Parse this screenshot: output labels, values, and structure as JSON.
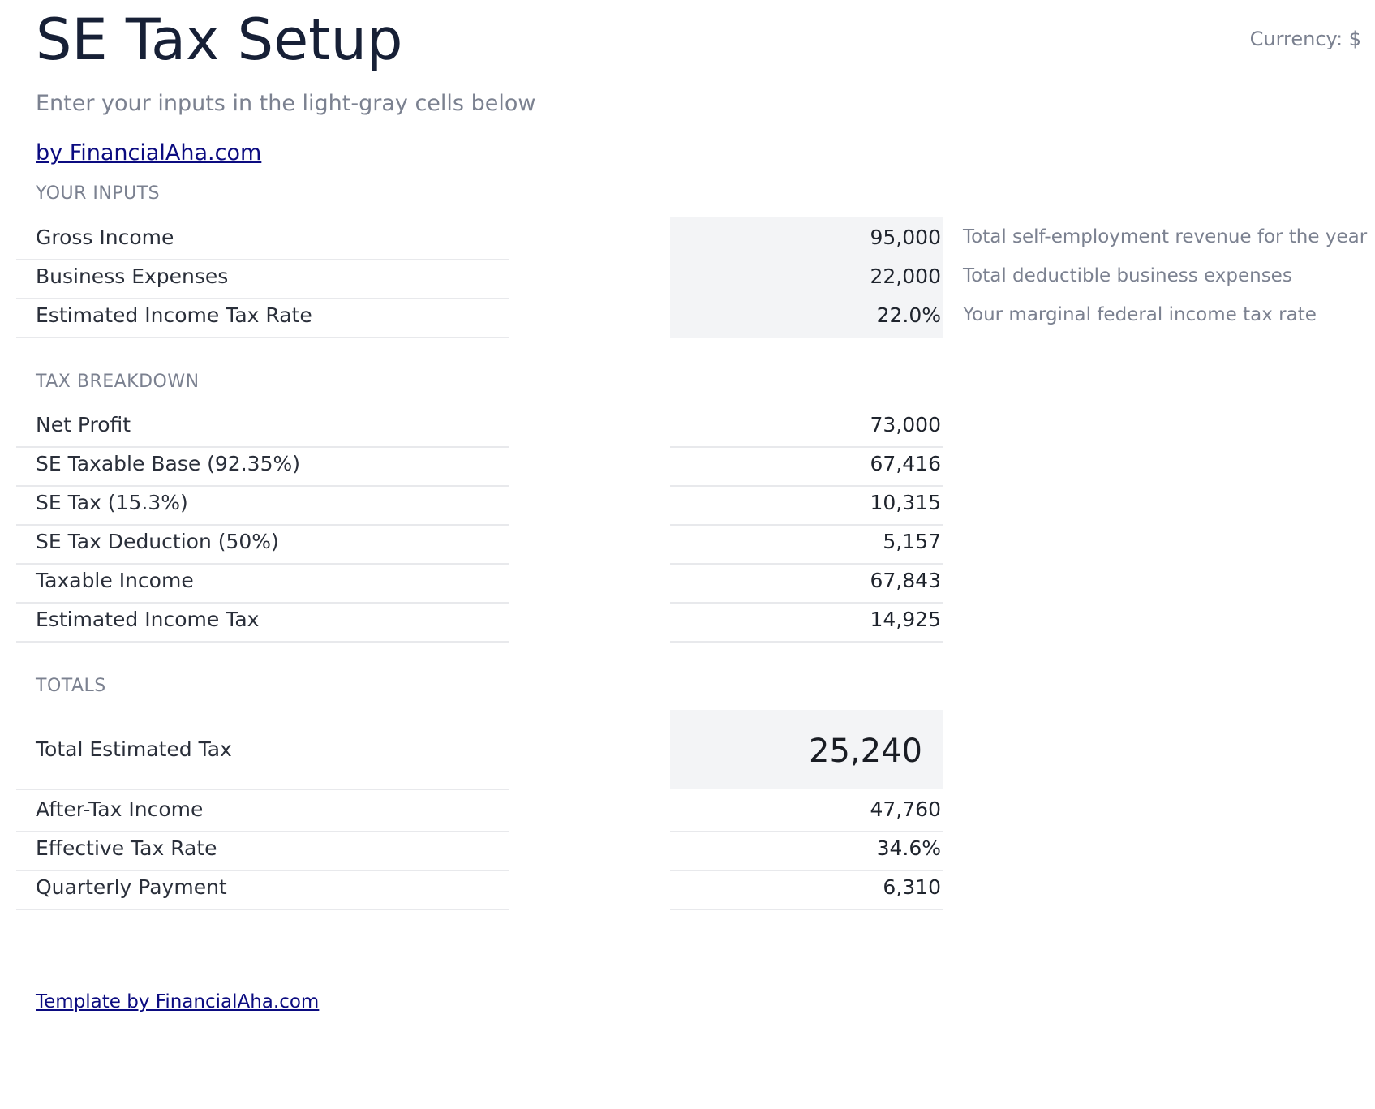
{
  "header": {
    "title": "SE Tax Setup",
    "currency": "Currency: $",
    "subtitle": "Enter your inputs in the light-gray cells below",
    "brand_link": "by FinancialAha.com"
  },
  "inputs": {
    "section_label": "YOUR INPUTS",
    "rows": [
      {
        "label": "Gross Income",
        "value": "95,000",
        "note": "Total self-employment revenue for the year"
      },
      {
        "label": "Business Expenses",
        "value": "22,000",
        "note": "Total deductible business expenses"
      },
      {
        "label": "Estimated Income Tax Rate",
        "value": "22.0%",
        "note": "Your marginal federal income tax rate"
      }
    ]
  },
  "breakdown": {
    "section_label": "TAX BREAKDOWN",
    "rows": [
      {
        "label": "Net Profit",
        "value": "73,000"
      },
      {
        "label": "SE Taxable Base (92.35%)",
        "value": "67,416"
      },
      {
        "label": "SE Tax (15.3%)",
        "value": "10,315"
      },
      {
        "label": "SE Tax Deduction (50%)",
        "value": "5,157"
      },
      {
        "label": "Taxable Income",
        "value": "67,843"
      },
      {
        "label": "Estimated Income Tax",
        "value": "14,925"
      }
    ]
  },
  "totals": {
    "section_label": "TOTALS",
    "total": {
      "label": "Total Estimated Tax",
      "value": "25,240"
    },
    "rows": [
      {
        "label": "After-Tax Income",
        "value": "47,760"
      },
      {
        "label": "Effective Tax Rate",
        "value": "34.6%"
      },
      {
        "label": "Quarterly Payment",
        "value": "6,310"
      }
    ]
  },
  "footer": {
    "link": "Template by FinancialAha.com"
  },
  "colors": {
    "input_cell_bg": "#f3f4f6",
    "title": "#172036",
    "muted": "#7b8190",
    "link": "#0b0b80"
  }
}
